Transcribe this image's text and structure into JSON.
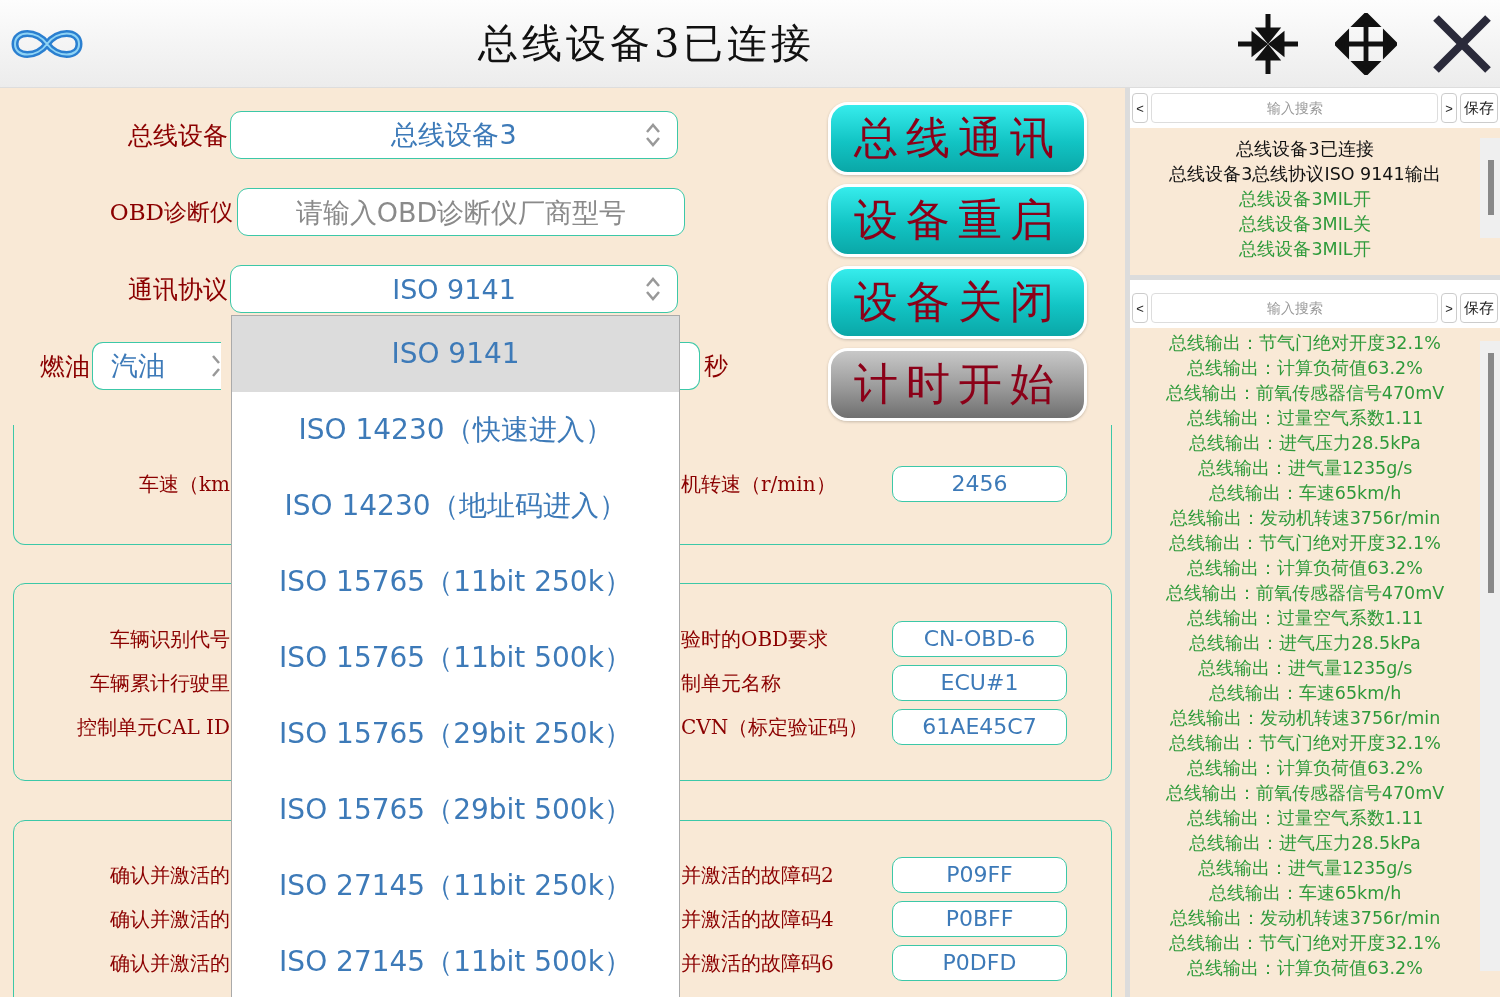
{
  "title_bar": {
    "title": "总线设备3已连接"
  },
  "form": {
    "device": {
      "label": "总线设备",
      "value": "总线设备3"
    },
    "obd": {
      "label": "OBD诊断仪",
      "placeholder": "请输入OBD诊断仪厂商型号"
    },
    "protocol": {
      "label": "通讯协议",
      "value": "ISO 9141",
      "expanded": true,
      "options": [
        {
          "label": "ISO 9141",
          "selected": true
        },
        {
          "label": "ISO 14230（快速进入）",
          "selected": false
        },
        {
          "label": "ISO 14230（地址码进入）",
          "selected": false
        },
        {
          "label": "ISO 15765（11bit 250k）",
          "selected": false
        },
        {
          "label": "ISO 15765（11bit 500k）",
          "selected": false
        },
        {
          "label": "ISO 15765（29bit 250k）",
          "selected": false
        },
        {
          "label": "ISO 15765（29bit 500k）",
          "selected": false
        },
        {
          "label": "ISO 27145（11bit 250k）",
          "selected": false
        },
        {
          "label": "ISO 27145（11bit 500k）",
          "selected": false
        }
      ]
    },
    "fuel": {
      "label": "燃油",
      "value": "汽油",
      "unit": "秒"
    }
  },
  "buttons": [
    {
      "label": "总线通讯",
      "kind": "teal"
    },
    {
      "label": "设备重启",
      "kind": "teal"
    },
    {
      "label": "设备关闭",
      "kind": "teal"
    },
    {
      "label": "计时开始",
      "kind": "grey"
    }
  ],
  "sections": [
    {
      "rows": [
        {
          "left_label": "车速（km",
          "right_label": "机转速（r/min）",
          "value": "2456"
        }
      ]
    },
    {
      "rows": [
        {
          "left_label": "车辆识别代号",
          "right_label": "验时的OBD要求",
          "value": "CN-OBD-6"
        },
        {
          "left_label": "车辆累计行驶里",
          "right_label": "制单元名称",
          "value": "ECU#1"
        },
        {
          "left_label": "控制单元CAL ID",
          "right_label": "CVN（标定验证码）",
          "value": "61AE45C7"
        }
      ]
    },
    {
      "rows": [
        {
          "left_label": "确认并激活的",
          "right_label": "并激活的故障码2",
          "value": "P09FF"
        },
        {
          "left_label": "确认并激活的",
          "right_label": "并激活的故障码4",
          "value": "P0BFF"
        },
        {
          "left_label": "确认并激活的",
          "right_label": "并激活的故障码6",
          "value": "P0DFD"
        }
      ]
    }
  ],
  "log_panels": [
    {
      "search_placeholder": "输入搜索",
      "prev": "<",
      "next": ">",
      "save": "保存",
      "lines": [
        {
          "text": "总线设备3已连接",
          "color": "#111111"
        },
        {
          "text": "总线设备3总线协议ISO 9141输出",
          "color": "#111111"
        },
        {
          "text": "总线设备3MIL开",
          "color": "#2e9a3a"
        },
        {
          "text": "总线设备3MIL关",
          "color": "#2e9a3a"
        },
        {
          "text": "总线设备3MIL开",
          "color": "#2e9a3a"
        }
      ]
    },
    {
      "search_placeholder": "输入搜索",
      "prev": "<",
      "next": ">",
      "save": "保存",
      "lines": [
        {
          "text": "总线输出：节气门绝对开度32.1%",
          "color": "#2e9a3a"
        },
        {
          "text": "总线输出：计算负荷值63.2%",
          "color": "#2e9a3a"
        },
        {
          "text": "总线输出：前氧传感器信号470mV",
          "color": "#2e9a3a"
        },
        {
          "text": "总线输出：过量空气系数1.11",
          "color": "#2e9a3a"
        },
        {
          "text": "总线输出：进气压力28.5kPa",
          "color": "#2e9a3a"
        },
        {
          "text": "总线输出：进气量1235g/s",
          "color": "#2e9a3a"
        },
        {
          "text": "总线输出：车速65km/h",
          "color": "#2e9a3a"
        },
        {
          "text": "总线输出：发动机转速3756r/min",
          "color": "#2e9a3a"
        },
        {
          "text": "总线输出：节气门绝对开度32.1%",
          "color": "#2e9a3a"
        },
        {
          "text": "总线输出：计算负荷值63.2%",
          "color": "#2e9a3a"
        },
        {
          "text": "总线输出：前氧传感器信号470mV",
          "color": "#2e9a3a"
        },
        {
          "text": "总线输出：过量空气系数1.11",
          "color": "#2e9a3a"
        },
        {
          "text": "总线输出：进气压力28.5kPa",
          "color": "#2e9a3a"
        },
        {
          "text": "总线输出：进气量1235g/s",
          "color": "#2e9a3a"
        },
        {
          "text": "总线输出：车速65km/h",
          "color": "#2e9a3a"
        },
        {
          "text": "总线输出：发动机转速3756r/min",
          "color": "#2e9a3a"
        },
        {
          "text": "总线输出：节气门绝对开度32.1%",
          "color": "#2e9a3a"
        },
        {
          "text": "总线输出：计算负荷值63.2%",
          "color": "#2e9a3a"
        },
        {
          "text": "总线输出：前氧传感器信号470mV",
          "color": "#2e9a3a"
        },
        {
          "text": "总线输出：过量空气系数1.11",
          "color": "#2e9a3a"
        },
        {
          "text": "总线输出：进气压力28.5kPa",
          "color": "#2e9a3a"
        },
        {
          "text": "总线输出：进气量1235g/s",
          "color": "#2e9a3a"
        },
        {
          "text": "总线输出：车速65km/h",
          "color": "#2e9a3a"
        },
        {
          "text": "总线输出：发动机转速3756r/min",
          "color": "#2e9a3a"
        },
        {
          "text": "总线输出：节气门绝对开度32.1%",
          "color": "#2e9a3a"
        },
        {
          "text": "总线输出：计算负荷值63.2%",
          "color": "#2e9a3a"
        }
      ]
    }
  ]
}
